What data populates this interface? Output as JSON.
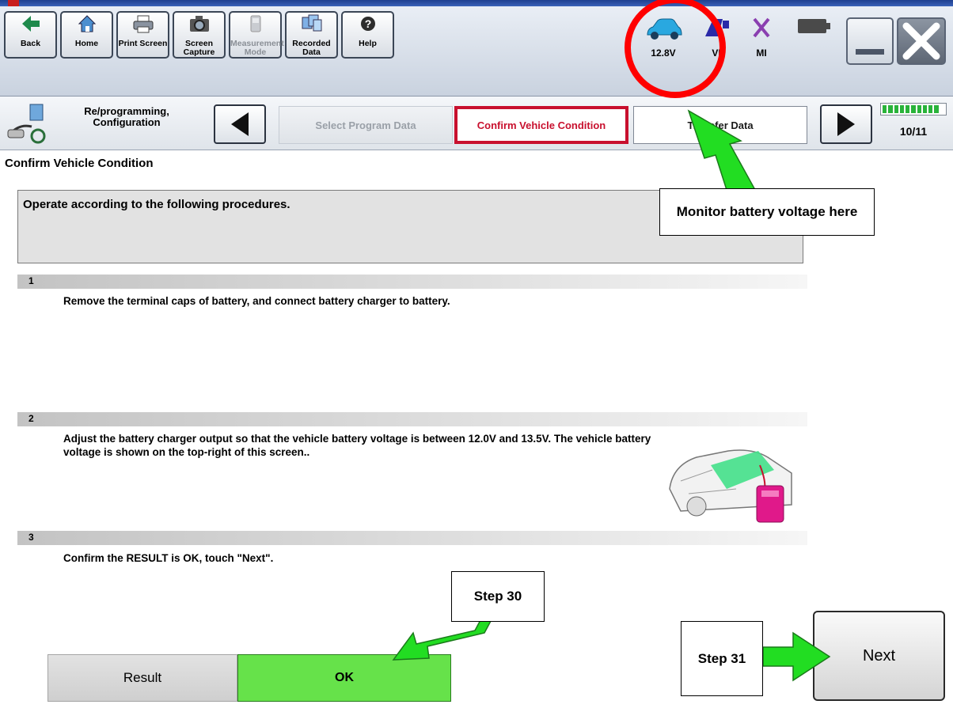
{
  "toolbar": {
    "buttons": [
      {
        "label": "Back",
        "icon": "back-arrow-icon"
      },
      {
        "label": "Home",
        "icon": "home-icon"
      },
      {
        "label": "Print Screen",
        "icon": "printer-icon"
      },
      {
        "label": "Screen Capture",
        "icon": "camera-icon"
      },
      {
        "label": "Measurement Mode",
        "icon": "measurement-icon"
      },
      {
        "label": "Recorded Data",
        "icon": "recorded-data-icon"
      },
      {
        "label": "Help",
        "icon": "help-icon"
      }
    ],
    "battery_voltage": "12.8V",
    "vi_label": "VI",
    "mi_label": "MI"
  },
  "nav": {
    "section_label": "Re/programming, Configuration",
    "steps": {
      "previous": "Select Program Data",
      "current": "Confirm Vehicle Condition",
      "next": "Transfer Data"
    },
    "progress_text": "10/11",
    "progress_fraction": 0.909
  },
  "page": {
    "title": "Confirm Vehicle Condition",
    "instruction": "Operate according to the following procedures."
  },
  "procedures": [
    {
      "number": "1",
      "text": "Remove the terminal caps of battery, and connect battery charger to battery."
    },
    {
      "number": "2",
      "text": "Adjust the battery charger output so that the vehicle battery voltage is between 12.0V and 13.5V. The vehicle battery voltage is shown on the top-right of this screen.."
    },
    {
      "number": "3",
      "text": "Confirm the RESULT is OK, touch \"Next\"."
    }
  ],
  "result": {
    "label": "Result",
    "value": "OK",
    "value_color": "#66e24a"
  },
  "next_button": "Next",
  "annotations": {
    "battery": "Monitor battery voltage here",
    "step30": "Step 30",
    "step31": "Step 31",
    "circle_color": "#ff0000",
    "arrow_color": "#22dd22"
  }
}
